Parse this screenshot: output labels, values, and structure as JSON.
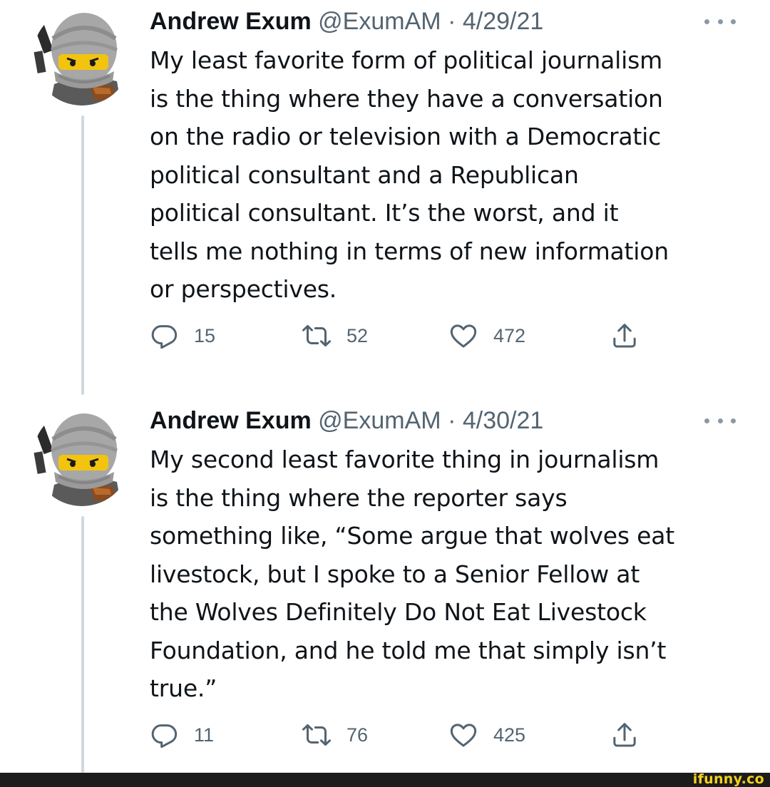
{
  "tweets": [
    {
      "author_name": "Andrew Exum",
      "handle": "@ExumAM",
      "separator": "·",
      "date": "4/29/21",
      "body_lines": [
        "My least favorite form of political journalism",
        "is the thing where they have a conversation",
        "on the radio or television with a Democratic",
        "political consultant and a Republican",
        "political consultant. It’s the worst, and it",
        "tells me nothing in terms of new information",
        "or perspectives."
      ],
      "replies": "15",
      "retweets": "52",
      "likes": "472",
      "icons": {
        "more": "more-horizontal-icon",
        "reply": "reply-icon",
        "retweet": "retweet-icon",
        "like": "heart-icon",
        "share": "share-icon"
      }
    },
    {
      "author_name": "Andrew Exum",
      "handle": "@ExumAM",
      "separator": "·",
      "date": "4/30/21",
      "body_lines": [
        "My second least favorite thing in journalism",
        "is the thing where the reporter says",
        "something like, “Some argue that wolves eat",
        "livestock, but I spoke to a Senior Fellow at",
        "the Wolves Definitely Do Not Eat Livestock",
        "Foundation, and he told me that simply isn’t",
        "true.”"
      ],
      "replies": "11",
      "retweets": "76",
      "likes": "425",
      "icons": {
        "more": "more-horizontal-icon",
        "reply": "reply-icon",
        "retweet": "retweet-icon",
        "like": "heart-icon",
        "share": "share-icon"
      }
    }
  ],
  "footer": {
    "watermark": "ifunny.co"
  },
  "colors": {
    "text": "#0f1419",
    "secondary_text": "#536471",
    "thread_line": "#cfd9de",
    "watermark": "#f4d21f",
    "footer_bar": "#1c1c1c"
  }
}
